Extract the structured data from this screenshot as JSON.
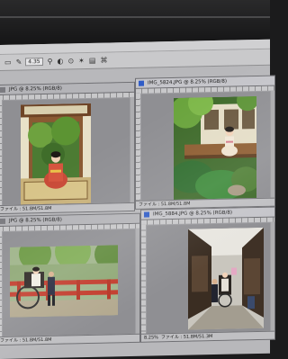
{
  "toolbar": {
    "brush_size": "4.35",
    "icons": [
      "marquee-icon",
      "brush-icon",
      "stamp-icon",
      "mode-icon",
      "pressure-icon",
      "options-icon"
    ]
  },
  "documents": [
    {
      "tab_label": "JPG @ 8.25% (RGB/8)",
      "status": "ファイル : 51.8M/51.8M",
      "active": false
    },
    {
      "tab_label": "IMG_5824.JPG @ 8.25% (RGB/8)",
      "status": "ファイル : 51.8M/51.8M",
      "active": true
    },
    {
      "tab_label": "JPG @ 8.25% (RGB/8)",
      "status": "ファイル : 51.8M/51.8M",
      "active": false
    },
    {
      "tab_label": "IMG_5884.JPG @ 8.25% (RGB/8)",
      "status": "ファイル : 51.8M/51.3M",
      "zoom": "8.25%",
      "active": true
    }
  ],
  "colors": {
    "accent": "#2f5cc7",
    "panel_bg": "#9d9da1"
  }
}
